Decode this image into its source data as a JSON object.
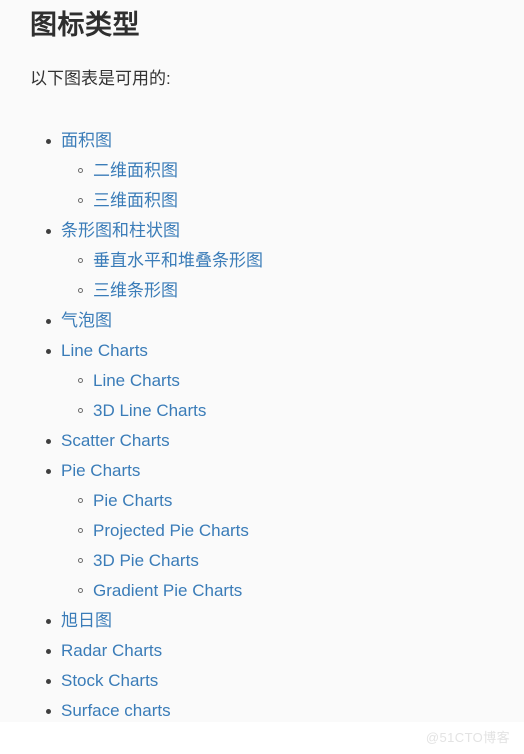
{
  "page": {
    "title": "图标类型",
    "intro": "以下图表是可用的:",
    "watermark": "@51CTO博客",
    "link_color": "#3a7cb8",
    "heading_color": "#2f2f2f",
    "text_color": "#333333",
    "content_background": "#fafafa",
    "page_background": "#ffffff",
    "watermark_color": "#e3e3e3"
  },
  "chart_list": [
    {
      "label": "面积图",
      "children": [
        {
          "label": "二维面积图"
        },
        {
          "label": "三维面积图"
        }
      ]
    },
    {
      "label": "条形图和柱状图",
      "children": [
        {
          "label": "垂直水平和堆叠条形图"
        },
        {
          "label": "三维条形图"
        }
      ]
    },
    {
      "label": "气泡图",
      "children": []
    },
    {
      "label": "Line Charts",
      "children": [
        {
          "label": "Line Charts"
        },
        {
          "label": "3D Line Charts"
        }
      ]
    },
    {
      "label": "Scatter Charts",
      "children": []
    },
    {
      "label": "Pie Charts",
      "children": [
        {
          "label": "Pie Charts"
        },
        {
          "label": "Projected Pie Charts"
        },
        {
          "label": "3D Pie Charts"
        },
        {
          "label": "Gradient Pie Charts"
        }
      ]
    },
    {
      "label": "旭日图",
      "children": []
    },
    {
      "label": "Radar Charts",
      "children": []
    },
    {
      "label": "Stock Charts",
      "children": []
    },
    {
      "label": "Surface charts",
      "children": []
    }
  ]
}
